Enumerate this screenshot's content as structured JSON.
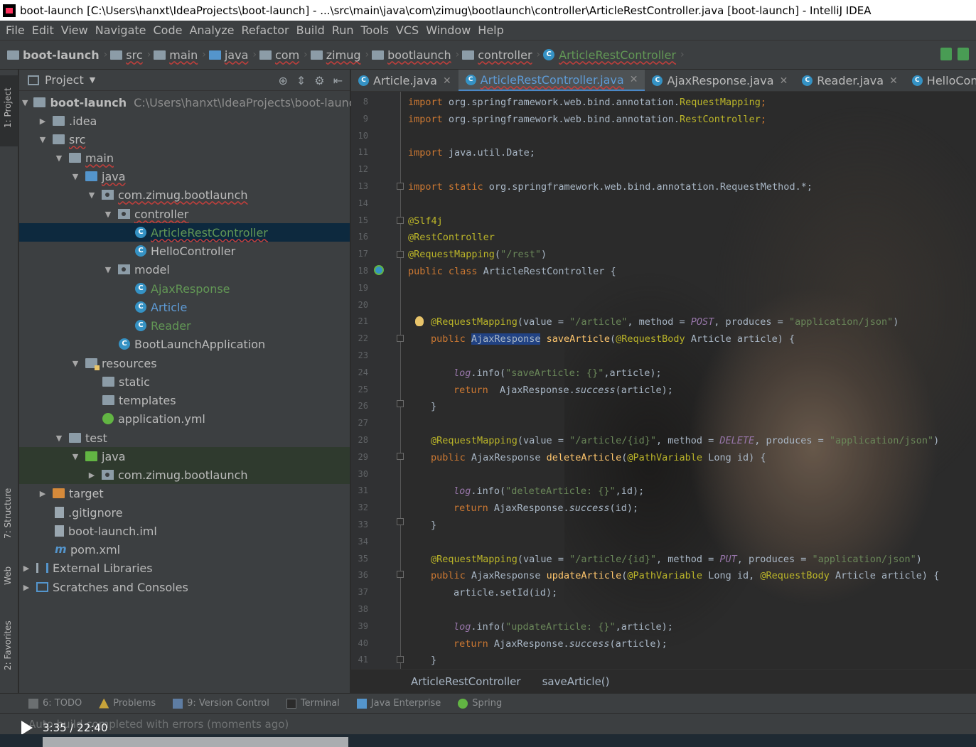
{
  "window": {
    "title": "boot-launch [C:\\Users\\hanxt\\IdeaProjects\\boot-launch] - ...\\src\\main\\java\\com\\zimug\\bootlaunch\\controller\\ArticleRestController.java [boot-launch] - IntelliJ IDEA"
  },
  "menu": [
    "File",
    "Edit",
    "View",
    "Navigate",
    "Code",
    "Analyze",
    "Refactor",
    "Build",
    "Run",
    "Tools",
    "VCS",
    "Window",
    "Help"
  ],
  "breadcrumbs": [
    "boot-launch",
    "src",
    "main",
    "java",
    "com",
    "zimug",
    "bootlaunch",
    "controller",
    "ArticleRestController"
  ],
  "left_stripe": {
    "project": "1: Project",
    "structure": "7: Structure",
    "web": "Web",
    "favorites": "2: Favorites"
  },
  "project_panel": {
    "title": "Project",
    "tree": [
      {
        "label": "boot-launch",
        "path": "C:\\Users\\hanxt\\IdeaProjects\\boot-launch"
      },
      {
        "label": ".idea"
      },
      {
        "label": "src"
      },
      {
        "label": "main"
      },
      {
        "label": "java"
      },
      {
        "label": "com.zimug.bootlaunch"
      },
      {
        "label": "controller"
      },
      {
        "label": "ArticleRestController"
      },
      {
        "label": "HelloController"
      },
      {
        "label": "model"
      },
      {
        "label": "AjaxResponse"
      },
      {
        "label": "Article"
      },
      {
        "label": "Reader"
      },
      {
        "label": "BootLaunchApplication"
      },
      {
        "label": "resources"
      },
      {
        "label": "static"
      },
      {
        "label": "templates"
      },
      {
        "label": "application.yml"
      },
      {
        "label": "test"
      },
      {
        "label": "java"
      },
      {
        "label": "com.zimug.bootlaunch"
      },
      {
        "label": "target"
      },
      {
        "label": ".gitignore"
      },
      {
        "label": "boot-launch.iml"
      },
      {
        "label": "pom.xml"
      },
      {
        "label": "External Libraries"
      },
      {
        "label": "Scratches and Consoles"
      }
    ]
  },
  "editor_tabs": [
    "Article.java",
    "ArticleRestController.java",
    "AjaxResponse.java",
    "Reader.java",
    "HelloController"
  ],
  "editor": {
    "line_numbers": [
      "8",
      "9",
      "10",
      "11",
      "12",
      "13",
      "14",
      "15",
      "16",
      "17",
      "18",
      "19",
      "20",
      "21",
      "22",
      "23",
      "24",
      "25",
      "26",
      "27",
      "28",
      "29",
      "30",
      "31",
      "32",
      "33",
      "34",
      "35",
      "36",
      "37",
      "38",
      "39",
      "40",
      "41"
    ],
    "code": {
      "l8_kw": "import",
      "l8_pkg": " org.springframework.web.bind.annotation.",
      "l8_cls": "RequestMapping",
      "l8_end": ";",
      "l9_kw": "import",
      "l9_pkg": " org.springframework.web.bind.annotation.",
      "l9_cls": "RestController",
      "l9_end": ";",
      "l11_kw": "import",
      "l11_pkg": " java.util.Date;",
      "l13_kw": "import static",
      "l13_pkg": " org.springframework.web.bind.annotation.RequestMethod.*;",
      "l15_ann": "@Slf4j",
      "l16_ann": "@RestController",
      "l17_ann": "@RequestMapping",
      "l17_a": "(",
      "l17_str": "\"/rest\"",
      "l17_b": ")",
      "l18_kw": "public class",
      "l18_rest": " ArticleRestController {",
      "l21_ann": "@RequestMapping",
      "l21_a": "(value = ",
      "l21_str1": "\"/article\"",
      "l21_b": ", method = ",
      "l21_const": "POST",
      "l21_c": ", produces = ",
      "l21_str2": "\"application/json\"",
      "l21_d": ")",
      "l22_kw": "public",
      "l22_type": "AjaxResponse",
      "l22_m": "saveArticle",
      "l22_ann": "@RequestBody",
      "l22_rest": " Article article) {",
      "l24_log": "log",
      "l24_a": ".info(",
      "l24_str": "\"saveArticle: {}\"",
      "l24_b": ",article);",
      "l25_kw": "return",
      "l25_a": "  AjaxResponse.",
      "l25_m": "success",
      "l25_b": "(article);",
      "l26": "}",
      "l28_ann": "@RequestMapping",
      "l28_a": "(value = ",
      "l28_str1": "\"/article/{id}\"",
      "l28_b": ", method = ",
      "l28_const": "DELETE",
      "l28_c": ", produces = ",
      "l28_str2": "\"application/json\"",
      "l28_d": ")",
      "l29_kw": "public",
      "l29_type": " AjaxResponse ",
      "l29_m": "deleteArticle",
      "l29_ann": "@PathVariable",
      "l29_rest": " Long id) {",
      "l31_log": "log",
      "l31_a": ".info(",
      "l31_str": "\"deleteArticle: {}\"",
      "l31_b": ",id);",
      "l32_kw": "return",
      "l32_a": " AjaxResponse.",
      "l32_m": "success",
      "l32_b": "(id);",
      "l33": "}",
      "l35_ann": "@RequestMapping",
      "l35_a": "(value = ",
      "l35_str1": "\"/article/{id}\"",
      "l35_b": ", method = ",
      "l35_const": "PUT",
      "l35_c": ", produces = ",
      "l35_str2": "\"application/json\"",
      "l35_d": ")",
      "l36_kw": "public",
      "l36_type": " AjaxResponse ",
      "l36_m": "updateArticle",
      "l36_ann1": "@PathVariable",
      "l36_mid": " Long id, ",
      "l36_ann2": "@RequestBody",
      "l36_rest": " Article article) {",
      "l37": "article.setId(id);",
      "l39_log": "log",
      "l39_a": ".info(",
      "l39_str": "\"updateArticle: {}\"",
      "l39_b": ",article);",
      "l40_kw": "return",
      "l40_a": " AjaxResponse.",
      "l40_m": "success",
      "l40_b": "(article);",
      "l41": "}"
    }
  },
  "editor_breadcrumb": [
    "ArticleRestController",
    "saveArticle()"
  ],
  "bottom_tabs": [
    "6: TODO",
    "Problems",
    "9: Version Control",
    "Terminal",
    "Java Enterprise",
    "Spring"
  ],
  "status": "Auto build completed with errors (moments ago)",
  "video": {
    "time": "3:35 / 22:40"
  },
  "colors": {
    "keyword": "#cc7832",
    "annotation": "#bbb529",
    "string": "#6a8759",
    "selection": "#0d293e",
    "accent": "#4a88c7"
  }
}
